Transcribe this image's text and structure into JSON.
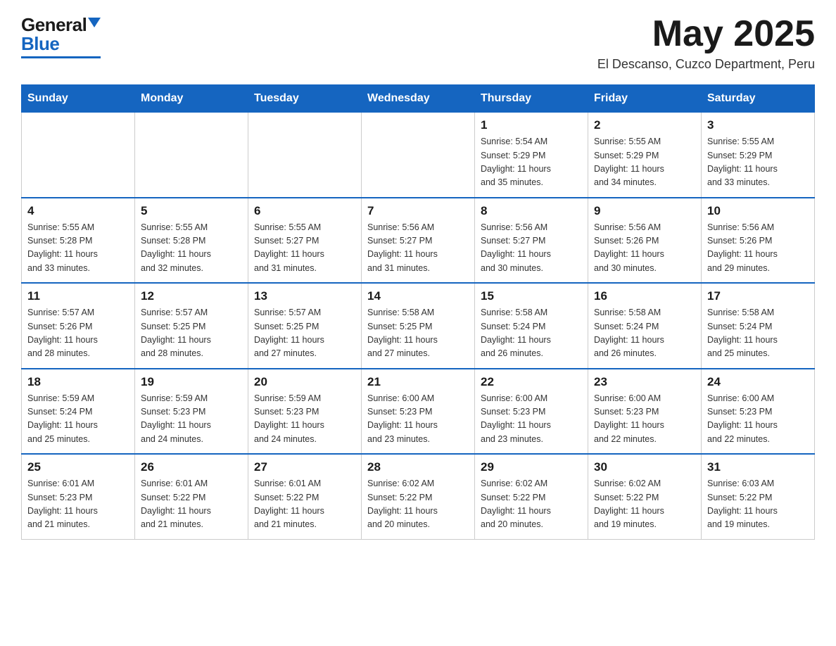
{
  "header": {
    "logo_general": "General",
    "logo_blue": "Blue",
    "month_title": "May 2025",
    "location": "El Descanso, Cuzco Department, Peru"
  },
  "days_of_week": [
    "Sunday",
    "Monday",
    "Tuesday",
    "Wednesday",
    "Thursday",
    "Friday",
    "Saturday"
  ],
  "weeks": [
    [
      {
        "day": "",
        "info": ""
      },
      {
        "day": "",
        "info": ""
      },
      {
        "day": "",
        "info": ""
      },
      {
        "day": "",
        "info": ""
      },
      {
        "day": "1",
        "info": "Sunrise: 5:54 AM\nSunset: 5:29 PM\nDaylight: 11 hours\nand 35 minutes."
      },
      {
        "day": "2",
        "info": "Sunrise: 5:55 AM\nSunset: 5:29 PM\nDaylight: 11 hours\nand 34 minutes."
      },
      {
        "day": "3",
        "info": "Sunrise: 5:55 AM\nSunset: 5:29 PM\nDaylight: 11 hours\nand 33 minutes."
      }
    ],
    [
      {
        "day": "4",
        "info": "Sunrise: 5:55 AM\nSunset: 5:28 PM\nDaylight: 11 hours\nand 33 minutes."
      },
      {
        "day": "5",
        "info": "Sunrise: 5:55 AM\nSunset: 5:28 PM\nDaylight: 11 hours\nand 32 minutes."
      },
      {
        "day": "6",
        "info": "Sunrise: 5:55 AM\nSunset: 5:27 PM\nDaylight: 11 hours\nand 31 minutes."
      },
      {
        "day": "7",
        "info": "Sunrise: 5:56 AM\nSunset: 5:27 PM\nDaylight: 11 hours\nand 31 minutes."
      },
      {
        "day": "8",
        "info": "Sunrise: 5:56 AM\nSunset: 5:27 PM\nDaylight: 11 hours\nand 30 minutes."
      },
      {
        "day": "9",
        "info": "Sunrise: 5:56 AM\nSunset: 5:26 PM\nDaylight: 11 hours\nand 30 minutes."
      },
      {
        "day": "10",
        "info": "Sunrise: 5:56 AM\nSunset: 5:26 PM\nDaylight: 11 hours\nand 29 minutes."
      }
    ],
    [
      {
        "day": "11",
        "info": "Sunrise: 5:57 AM\nSunset: 5:26 PM\nDaylight: 11 hours\nand 28 minutes."
      },
      {
        "day": "12",
        "info": "Sunrise: 5:57 AM\nSunset: 5:25 PM\nDaylight: 11 hours\nand 28 minutes."
      },
      {
        "day": "13",
        "info": "Sunrise: 5:57 AM\nSunset: 5:25 PM\nDaylight: 11 hours\nand 27 minutes."
      },
      {
        "day": "14",
        "info": "Sunrise: 5:58 AM\nSunset: 5:25 PM\nDaylight: 11 hours\nand 27 minutes."
      },
      {
        "day": "15",
        "info": "Sunrise: 5:58 AM\nSunset: 5:24 PM\nDaylight: 11 hours\nand 26 minutes."
      },
      {
        "day": "16",
        "info": "Sunrise: 5:58 AM\nSunset: 5:24 PM\nDaylight: 11 hours\nand 26 minutes."
      },
      {
        "day": "17",
        "info": "Sunrise: 5:58 AM\nSunset: 5:24 PM\nDaylight: 11 hours\nand 25 minutes."
      }
    ],
    [
      {
        "day": "18",
        "info": "Sunrise: 5:59 AM\nSunset: 5:24 PM\nDaylight: 11 hours\nand 25 minutes."
      },
      {
        "day": "19",
        "info": "Sunrise: 5:59 AM\nSunset: 5:23 PM\nDaylight: 11 hours\nand 24 minutes."
      },
      {
        "day": "20",
        "info": "Sunrise: 5:59 AM\nSunset: 5:23 PM\nDaylight: 11 hours\nand 24 minutes."
      },
      {
        "day": "21",
        "info": "Sunrise: 6:00 AM\nSunset: 5:23 PM\nDaylight: 11 hours\nand 23 minutes."
      },
      {
        "day": "22",
        "info": "Sunrise: 6:00 AM\nSunset: 5:23 PM\nDaylight: 11 hours\nand 23 minutes."
      },
      {
        "day": "23",
        "info": "Sunrise: 6:00 AM\nSunset: 5:23 PM\nDaylight: 11 hours\nand 22 minutes."
      },
      {
        "day": "24",
        "info": "Sunrise: 6:00 AM\nSunset: 5:23 PM\nDaylight: 11 hours\nand 22 minutes."
      }
    ],
    [
      {
        "day": "25",
        "info": "Sunrise: 6:01 AM\nSunset: 5:23 PM\nDaylight: 11 hours\nand 21 minutes."
      },
      {
        "day": "26",
        "info": "Sunrise: 6:01 AM\nSunset: 5:22 PM\nDaylight: 11 hours\nand 21 minutes."
      },
      {
        "day": "27",
        "info": "Sunrise: 6:01 AM\nSunset: 5:22 PM\nDaylight: 11 hours\nand 21 minutes."
      },
      {
        "day": "28",
        "info": "Sunrise: 6:02 AM\nSunset: 5:22 PM\nDaylight: 11 hours\nand 20 minutes."
      },
      {
        "day": "29",
        "info": "Sunrise: 6:02 AM\nSunset: 5:22 PM\nDaylight: 11 hours\nand 20 minutes."
      },
      {
        "day": "30",
        "info": "Sunrise: 6:02 AM\nSunset: 5:22 PM\nDaylight: 11 hours\nand 19 minutes."
      },
      {
        "day": "31",
        "info": "Sunrise: 6:03 AM\nSunset: 5:22 PM\nDaylight: 11 hours\nand 19 minutes."
      }
    ]
  ]
}
